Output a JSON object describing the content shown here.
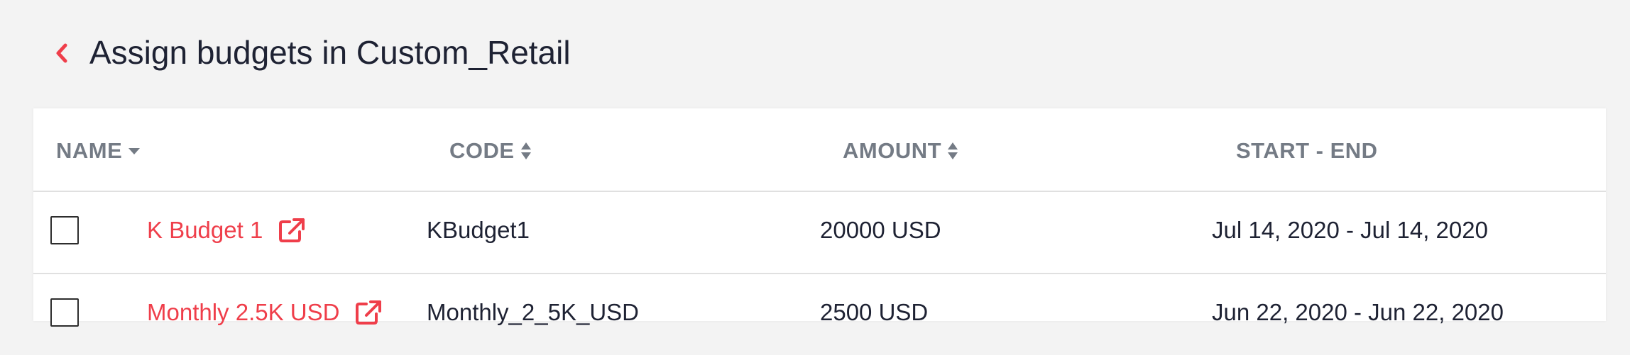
{
  "header": {
    "title": "Assign budgets in Custom_Retail",
    "back_icon": "chevron-left-icon"
  },
  "colors": {
    "accent": "#ef3e4a",
    "background": "#f3f3f3",
    "header_text": "#747b85",
    "body_text": "#1e2233"
  },
  "table": {
    "columns": [
      {
        "label": "NAME",
        "sort": "descending"
      },
      {
        "label": "CODE",
        "sort": "sortable"
      },
      {
        "label": "AMOUNT",
        "sort": "sortable"
      },
      {
        "label": "START - END",
        "sort": "none"
      }
    ],
    "rows": [
      {
        "name": "K Budget 1",
        "code": "KBudget1",
        "amount": "20000 USD",
        "dates": "Jul 14, 2020 - Jul 14, 2020",
        "checked": false
      },
      {
        "name": "Monthly 2.5K USD",
        "code": "Monthly_2_5K_USD",
        "amount": "2500 USD",
        "dates": "Jun 22, 2020 - Jun 22, 2020",
        "checked": false
      }
    ]
  }
}
